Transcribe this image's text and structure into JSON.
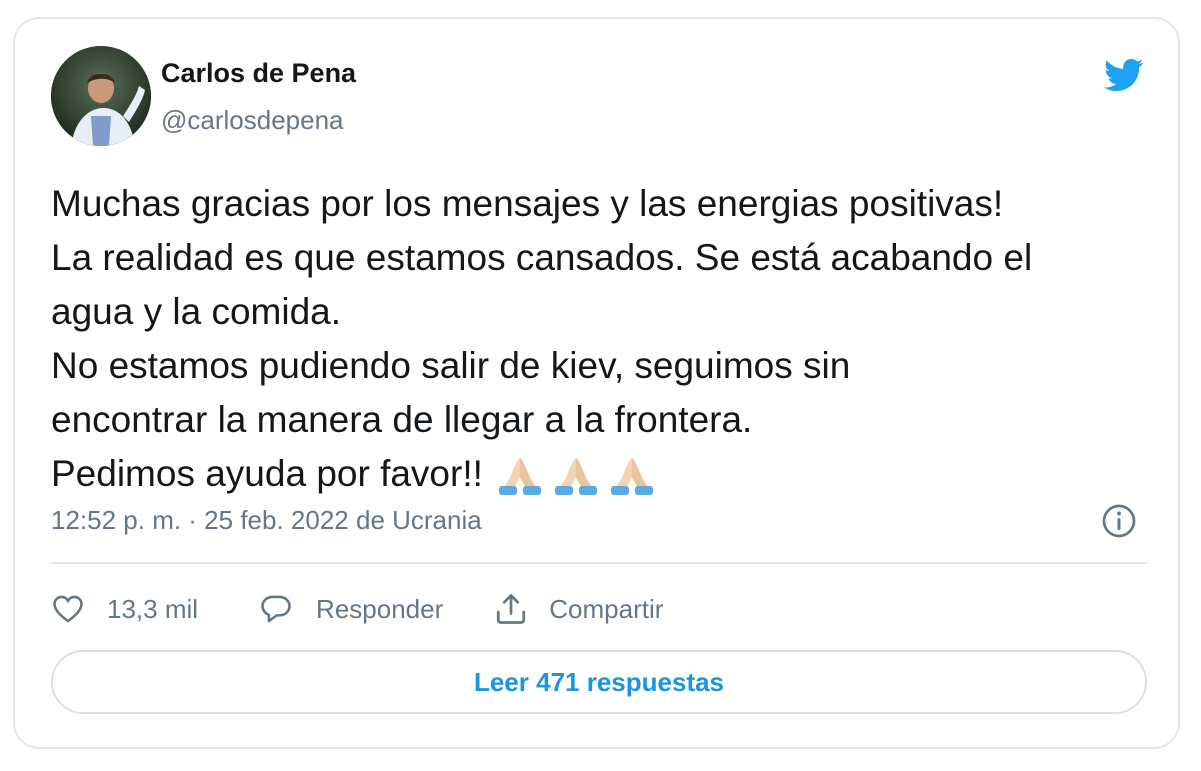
{
  "author": {
    "name": "Carlos de Pena",
    "handle": "@carlosdepena",
    "avatar_icon": "profile-photo"
  },
  "brand": {
    "icon": "twitter-bird-icon",
    "color": "#1da1f2"
  },
  "tweet": {
    "lines": [
      "Muchas gracias por los mensajes y las energias positivas!",
      "La realidad es que estamos cansados. Se está acabando el",
      "agua y la comida.",
      "No estamos pudiendo salir de kiev, seguimos sin",
      "encontrar la manera de llegar a la frontera.",
      "Pedimos ayuda por favor!!"
    ],
    "emoji": [
      "folded-hands",
      "folded-hands",
      "folded-hands"
    ]
  },
  "meta": {
    "timestamp": "12:52 p. m. · 25 feb. 2022 de Ucrania",
    "info_icon": "info-icon"
  },
  "actions": {
    "like_count": "13,3 mil",
    "reply_label": "Responder",
    "share_label": "Compartir"
  },
  "read_replies_label": "Leer 471 respuestas",
  "colors": {
    "text": "#14171a",
    "secondary": "#657786",
    "accent": "#1b95e0",
    "border": "#e1e8ed"
  }
}
